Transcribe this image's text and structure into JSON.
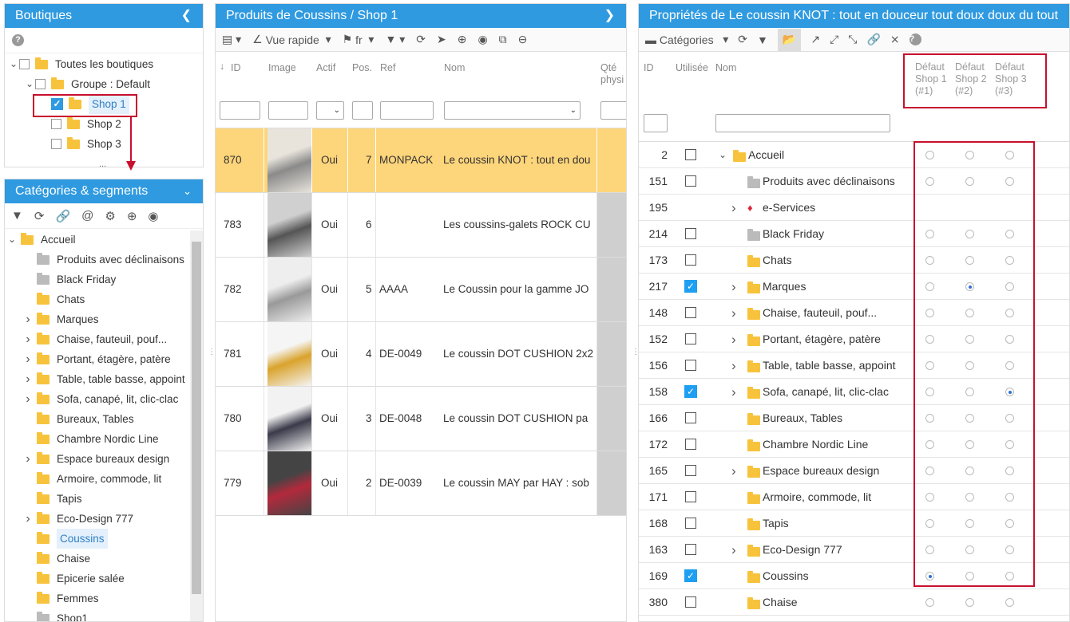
{
  "boutiques": {
    "title": "Boutiques",
    "tree": [
      {
        "label": "Toutes les boutiques"
      },
      {
        "label": "Groupe : Default"
      },
      {
        "label": "Shop 1",
        "checked": true
      },
      {
        "label": "Shop 2"
      },
      {
        "label": "Shop 3"
      }
    ],
    "ellipsis": "..."
  },
  "categories": {
    "title": "Catégories & segments",
    "tree": [
      "Accueil",
      "Produits avec déclinaisons",
      "Black Friday",
      "Chats",
      "Marques",
      "Chaise, fauteuil, pouf...",
      "Portant, étagère, patère",
      "Table, table basse, appoint",
      "Sofa, canapé, lit, clic-clac",
      "Bureaux, Tables",
      "Chambre Nordic Line",
      "Espace bureaux design",
      "Armoire, commode, lit",
      "Tapis",
      "Eco-Design 777",
      "Coussins",
      "Chaise",
      "Epicerie salée",
      "Femmes",
      "Shop1"
    ]
  },
  "products": {
    "title": "Produits de Coussins / Shop 1",
    "toolbar": {
      "quick_view": "Vue rapide",
      "lang": "fr"
    },
    "columns": {
      "id": "ID",
      "image": "Image",
      "active": "Actif",
      "pos": "Pos.",
      "ref": "Ref",
      "name": "Nom",
      "qty": "Qté physi"
    },
    "rows": [
      {
        "id": "870",
        "active": "Oui",
        "pos": "7",
        "ref": "MONPACK",
        "name": "Le coussin KNOT : tout en dou"
      },
      {
        "id": "783",
        "active": "Oui",
        "pos": "6",
        "ref": "",
        "name": "Les coussins-galets ROCK CU"
      },
      {
        "id": "782",
        "active": "Oui",
        "pos": "5",
        "ref": "AAAA",
        "name": "Le Coussin pour la gamme JO"
      },
      {
        "id": "781",
        "active": "Oui",
        "pos": "4",
        "ref": "DE-0049",
        "name": "Le coussin DOT CUSHION 2x2"
      },
      {
        "id": "780",
        "active": "Oui",
        "pos": "3",
        "ref": "DE-0048",
        "name": "Le coussin DOT CUSHION pa"
      },
      {
        "id": "779",
        "active": "Oui",
        "pos": "2",
        "ref": "DE-0039",
        "name": "Le coussin MAY par HAY : sob"
      }
    ]
  },
  "properties": {
    "title": "Propriétés de Le coussin KNOT : tout en douceur tout doux doux du tout",
    "toolbar": {
      "categories": "Catégories"
    },
    "columns": {
      "id": "ID",
      "used": "Utilisée",
      "name": "Nom",
      "shop1": [
        "Défaut",
        "Shop 1",
        "(#1)"
      ],
      "shop2": [
        "Défaut",
        "Shop 2",
        "(#2)"
      ],
      "shop3": [
        "Défaut",
        "Shop 3",
        "(#3)"
      ]
    },
    "rows": [
      {
        "id": "2",
        "name": "Accueil",
        "used": false,
        "expand": "down",
        "folder": "yellow",
        "radio": 0
      },
      {
        "id": "151",
        "name": "Produits avec déclinaisons",
        "used": false,
        "folder": "gray",
        "radio": 0
      },
      {
        "id": "195",
        "name": "e-Services",
        "noCheck": true,
        "expand": "right",
        "folder": "gem",
        "noRadio": true
      },
      {
        "id": "214",
        "name": "Black Friday",
        "used": false,
        "folder": "gray",
        "radio": 0
      },
      {
        "id": "173",
        "name": "Chats",
        "used": false,
        "folder": "yellow",
        "radio": 0
      },
      {
        "id": "217",
        "name": "Marques",
        "used": true,
        "expand": "right",
        "folder": "yellow",
        "radio": 2
      },
      {
        "id": "148",
        "name": "Chaise, fauteuil, pouf...",
        "used": false,
        "expand": "right",
        "folder": "yellow",
        "radio": 0
      },
      {
        "id": "152",
        "name": "Portant, étagère, patère",
        "used": false,
        "expand": "right",
        "folder": "yellow",
        "radio": 0
      },
      {
        "id": "156",
        "name": "Table, table basse, appoint",
        "used": false,
        "expand": "right",
        "folder": "yellow",
        "radio": 0
      },
      {
        "id": "158",
        "name": "Sofa, canapé, lit, clic-clac",
        "used": true,
        "expand": "right",
        "folder": "yellow",
        "radio": 3
      },
      {
        "id": "166",
        "name": "Bureaux, Tables",
        "used": false,
        "folder": "yellow",
        "radio": 0
      },
      {
        "id": "172",
        "name": "Chambre Nordic Line",
        "used": false,
        "folder": "yellow",
        "radio": 0
      },
      {
        "id": "165",
        "name": "Espace bureaux design",
        "used": false,
        "expand": "right",
        "folder": "yellow",
        "radio": 0
      },
      {
        "id": "171",
        "name": "Armoire, commode, lit",
        "used": false,
        "folder": "yellow",
        "radio": 0
      },
      {
        "id": "168",
        "name": "Tapis",
        "used": false,
        "folder": "yellow",
        "radio": 0
      },
      {
        "id": "163",
        "name": "Eco-Design 777",
        "used": false,
        "expand": "right",
        "folder": "yellow",
        "radio": 0
      },
      {
        "id": "169",
        "name": "Coussins",
        "used": true,
        "folder": "yellow",
        "radio": 1
      },
      {
        "id": "380",
        "name": "Chaise",
        "used": false,
        "folder": "yellow",
        "radio": 0
      }
    ]
  },
  "colors": {
    "header": "#2f9ae0",
    "highlight_row": "#fdd57a",
    "annotation": "#c8102e"
  }
}
